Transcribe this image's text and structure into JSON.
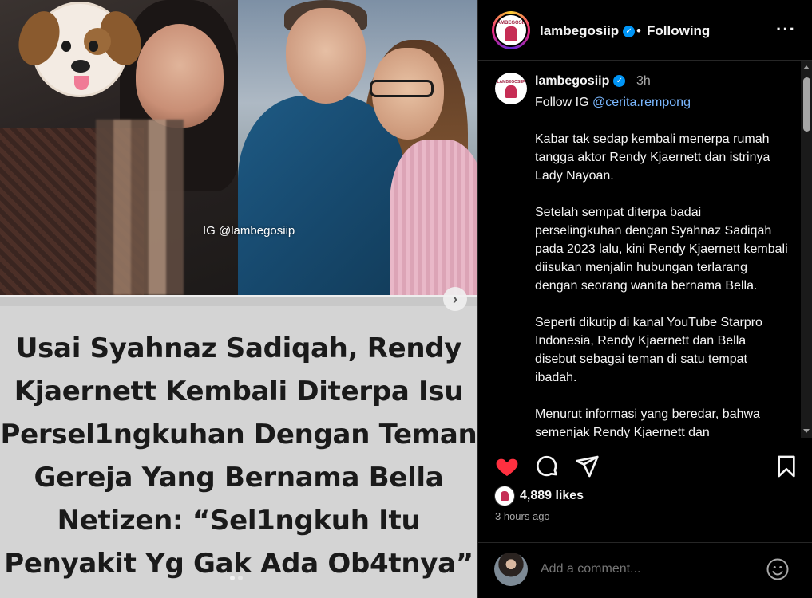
{
  "media": {
    "watermark": "IG @lambegosiip",
    "headline_lines": [
      "Usai Syahnaz Sadiqah, Rendy",
      "Kjaernett Kembali Diterpa Isu",
      "Persel1ngkuhan Dengan Teman",
      "Gereja Yang Bernama Bella",
      "Netizen: “Sel1ngkuh Itu",
      "Penyakit Yg Gak Ada Ob4tnya”"
    ],
    "next_button": "›",
    "carousel_dots": 2
  },
  "header": {
    "username": "lambegosiip",
    "verified": "✓",
    "separator": "•",
    "following": "Following",
    "more": "···",
    "logo_text": "LAMBEGOSIIP"
  },
  "caption": {
    "username": "lambegosiip",
    "verified": "✓",
    "time": "3h",
    "line_follow_prefix": "Follow IG ",
    "mention": "@cerita.rempong",
    "paragraphs": [
      "Kabar tak sedap kembali menerpa rumah tangga aktor Rendy Kjaernett dan istrinya Lady Nayoan.",
      "Setelah sempat diterpa badai perselingkuhan dengan Syahnaz Sadiqah pada 2023 lalu, kini Rendy Kjaernett kembali diisukan menjalin hubungan terlarang dengan seorang wanita bernama Bella.",
      "Seperti dikutip di kanal YouTube Starpro Indonesia, Rendy Kjaernett dan Bella disebut sebagai teman di satu tempat ibadah.",
      "Menurut informasi yang beredar, bahwa semenjak Rendy Kjaernett dan"
    ]
  },
  "actions": {
    "icons": [
      "heart-icon",
      "comment-icon",
      "share-icon",
      "bookmark-icon"
    ],
    "like_color": "#ff3040",
    "likes": "4,889 likes",
    "time_ago": "3 hours ago"
  },
  "comment": {
    "placeholder": "Add a comment..."
  }
}
